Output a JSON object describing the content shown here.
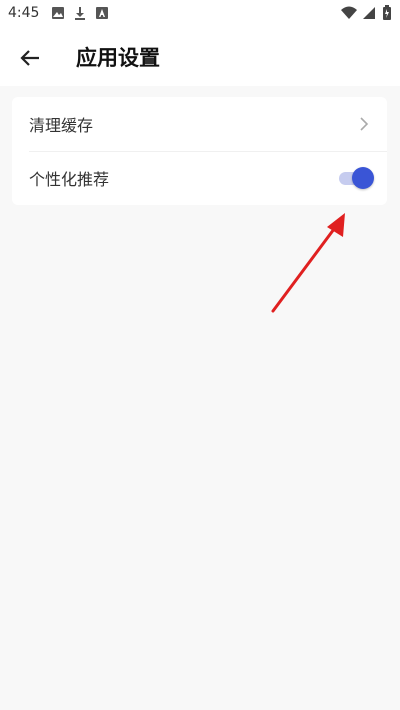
{
  "status_bar": {
    "time": "4:45",
    "icons": [
      "image-icon",
      "download-icon",
      "a-box-icon",
      "wifi-icon",
      "signal-icon",
      "battery-icon"
    ]
  },
  "app_bar": {
    "title": "应用设置",
    "back_icon": "back-arrow-icon"
  },
  "settings": {
    "items": [
      {
        "label": "清理缓存",
        "control": "chevron"
      },
      {
        "label": "个性化推荐",
        "control": "toggle",
        "toggle_on": true
      }
    ]
  },
  "colors": {
    "background": "#f8f8f8",
    "card": "#ffffff",
    "toggle_thumb": "#3a55d6",
    "toggle_track": "#c6ccef",
    "annotation_arrow": "#e02020"
  }
}
